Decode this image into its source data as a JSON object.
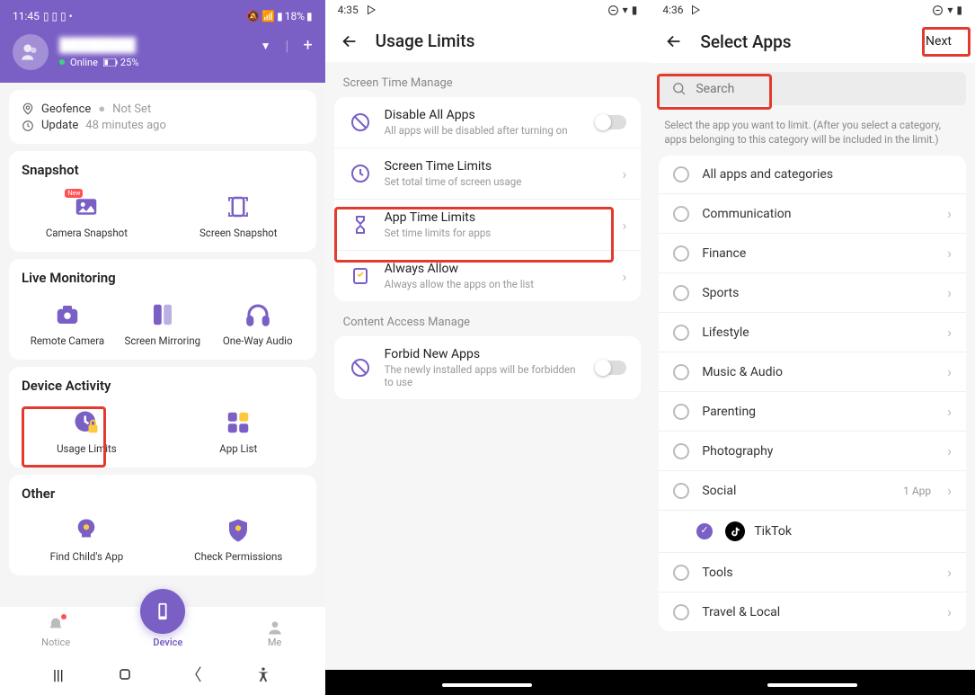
{
  "phone1": {
    "status": {
      "time": "11:45",
      "battery_pct": "18%"
    },
    "user": {
      "name": "████████",
      "status": "Online",
      "battery": "25%"
    },
    "info": {
      "geofence_label": "Geofence",
      "geofence_value": "Not Set",
      "update_label": "Update",
      "update_value": "48 minutes ago"
    },
    "snapshot": {
      "title": "Snapshot",
      "camera": "Camera Snapshot",
      "screen": "Screen Snapshot",
      "new_badge": "New"
    },
    "live": {
      "title": "Live Monitoring",
      "remote": "Remote Camera",
      "mirror": "Screen Mirroring",
      "audio": "One-Way Audio"
    },
    "activity": {
      "title": "Device Activity",
      "usage": "Usage Limits",
      "applist": "App List"
    },
    "other": {
      "title": "Other",
      "find": "Find Child's App",
      "perm": "Check Permissions"
    },
    "nav": {
      "notice": "Notice",
      "device": "Device",
      "me": "Me"
    }
  },
  "phone2": {
    "status": {
      "time": "4:35"
    },
    "title": "Usage Limits",
    "section1": "Screen Time Manage",
    "section2": "Content Access Manage",
    "rows": {
      "disable": {
        "t": "Disable All Apps",
        "s": "All apps will be disabled after turning on"
      },
      "screentime": {
        "t": "Screen Time Limits",
        "s": "Set total time of screen usage"
      },
      "apptime": {
        "t": "App Time Limits",
        "s": "Set time limits for apps"
      },
      "always": {
        "t": "Always Allow",
        "s": "Always allow the apps on the list"
      },
      "forbid": {
        "t": "Forbid New Apps",
        "s": "The newly installed apps will be forbidden to use"
      }
    }
  },
  "phone3": {
    "status": {
      "time": "4:36"
    },
    "title": "Select Apps",
    "next": "Next",
    "search_placeholder": "Search",
    "help": "Select the app you want to limit. (After you select a category, apps belonging to this category will be included in the limit.)",
    "cats": {
      "all": "All apps and categories",
      "comm": "Communication",
      "fin": "Finance",
      "sport": "Sports",
      "life": "Lifestyle",
      "music": "Music & Audio",
      "parent": "Parenting",
      "photo": "Photography",
      "social": "Social",
      "social_meta": "1 App",
      "tiktok": "TikTok",
      "tools": "Tools",
      "travel": "Travel & Local"
    }
  }
}
